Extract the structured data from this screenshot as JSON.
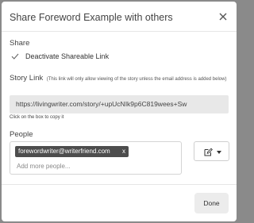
{
  "dialog": {
    "title": "Share Foreword Example with others"
  },
  "share": {
    "section_label": "Share",
    "checkbox_label": "Deactivate Shareable Link",
    "checked": true
  },
  "story_link": {
    "title": "Story Link",
    "note": "(This link will only allow viewing of the story unless the email address is added below)",
    "url": "https://livingwriter.com/story/+upUcNIk9p6C819wees+Sw",
    "hint": "Click on the box to copy it"
  },
  "people": {
    "label": "People",
    "chips": [
      "forewordwriter@writerfriend.com"
    ],
    "chip_remove": "x",
    "placeholder": "Add more people..."
  },
  "icons": {
    "close": "close-icon",
    "checkbox": "checkmark-icon",
    "permission": "edit-icon",
    "caret": "caret-down-icon"
  },
  "footer": {
    "done_label": "Done"
  },
  "colors": {
    "overlay": "#8a8a8a",
    "chip_bg": "#4d4d4d",
    "link_box_bg": "#e8e8e8",
    "done_bg": "#ececec"
  }
}
